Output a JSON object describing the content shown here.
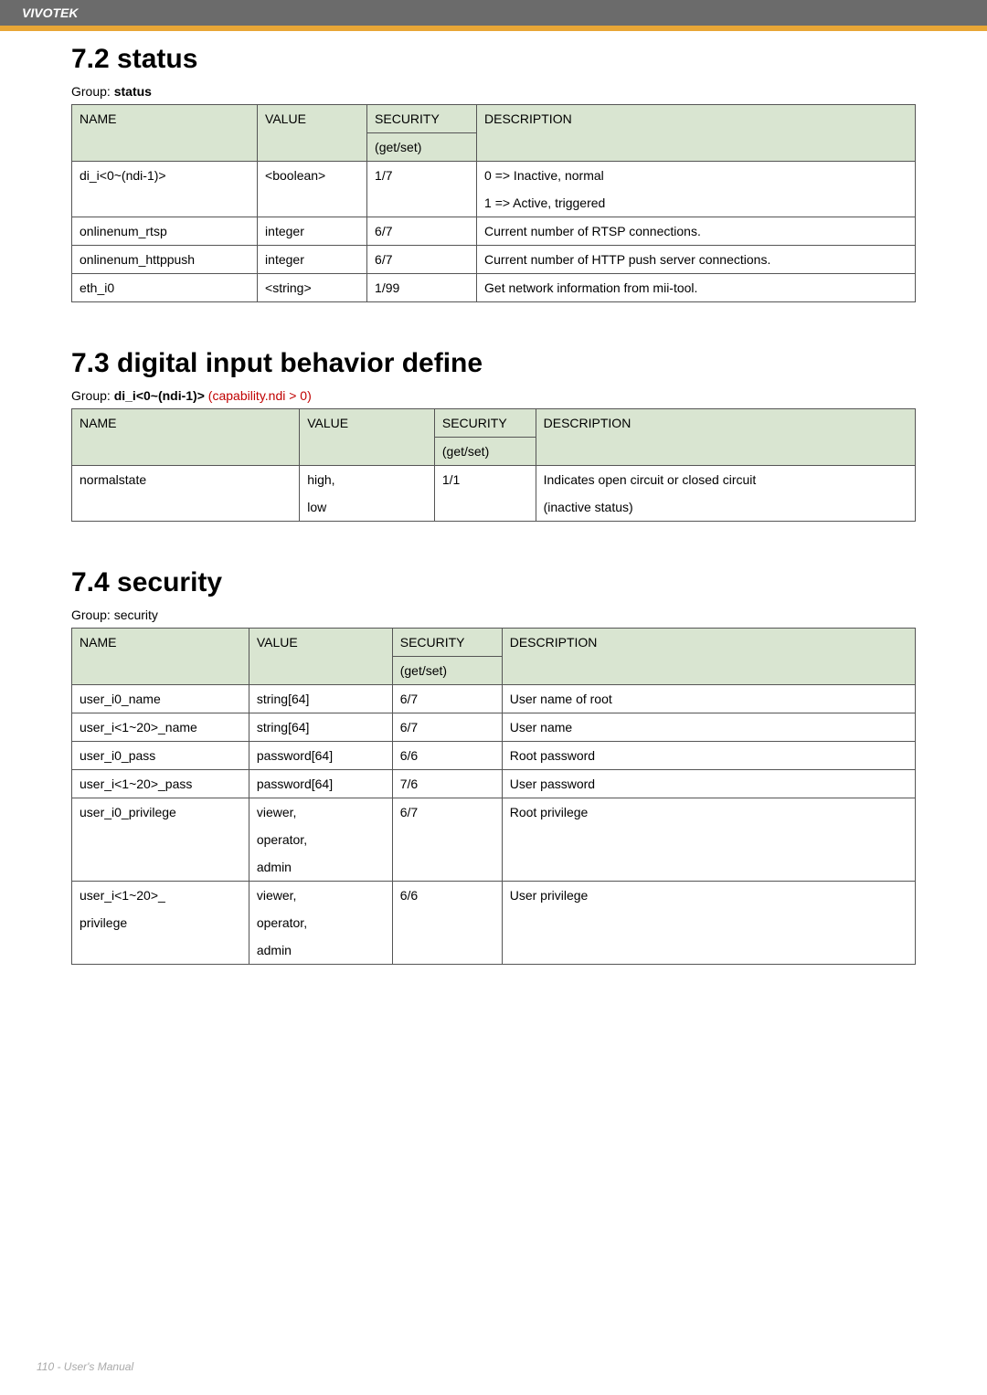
{
  "header": {
    "brand": "VIVOTEK"
  },
  "section72": {
    "title": "7.2 status",
    "group_label": "Group: ",
    "group_value": "status",
    "headers": {
      "name": "NAME",
      "value": "VALUE",
      "security": "SECURITY",
      "security_sub": "(get/set)",
      "description": "DESCRIPTION"
    },
    "rows": [
      {
        "name": "di_i<0~(ndi-1)>",
        "value": "<boolean>",
        "security": "1/7",
        "desc_line1": "0 => Inactive, normal",
        "desc_line2": "1 => Active, triggered"
      },
      {
        "name": "onlinenum_rtsp",
        "value": "integer",
        "security": "6/7",
        "desc": "Current number of RTSP connections."
      },
      {
        "name": "onlinenum_httppush",
        "value": "integer",
        "security": "6/7",
        "desc": "Current number of HTTP push server connections."
      },
      {
        "name": "eth_i0",
        "value": "<string>",
        "security": "1/99",
        "desc": "Get network information from mii-tool."
      }
    ]
  },
  "section73": {
    "title": "7.3 digital input behavior define",
    "group_label": "Group: ",
    "group_value": "di_i<0~(ndi-1)>",
    "group_suffix": " (capability.ndi > 0)",
    "headers": {
      "name": "NAME",
      "value": "VALUE",
      "security": "SECURITY",
      "security_sub": "(get/set)",
      "description": "DESCRIPTION"
    },
    "rows": [
      {
        "name": "normalstate",
        "value_line1": "high,",
        "value_line2": "low",
        "security": "1/1",
        "desc_line1": "Indicates open circuit or closed circuit",
        "desc_line2": "(inactive status)"
      }
    ]
  },
  "section74": {
    "title": "7.4 security",
    "group_label": "Group: security",
    "headers": {
      "name": "NAME",
      "value": "VALUE",
      "security": "SECURITY",
      "security_sub": "(get/set)",
      "description": "DESCRIPTION"
    },
    "rows": [
      {
        "name": "user_i0_name",
        "value": "string[64]",
        "security": "6/7",
        "desc": "User name of root"
      },
      {
        "name": "user_i<1~20>_name",
        "value": "string[64]",
        "security": "6/7",
        "desc": "User name"
      },
      {
        "name": "user_i0_pass",
        "value": "password[64]",
        "security": "6/6",
        "desc": "Root password"
      },
      {
        "name": "user_i<1~20>_pass",
        "value": "password[64]",
        "security": "7/6",
        "desc": "User password"
      },
      {
        "name": "user_i0_privilege",
        "value_line1": "viewer,",
        "value_line2": "operator,",
        "value_line3": "admin",
        "security": "6/7",
        "desc": "Root privilege"
      },
      {
        "name_line1": "user_i<1~20>_",
        "name_line2": "privilege",
        "value_line1": "viewer,",
        "value_line2": "operator,",
        "value_line3": "admin",
        "security": "6/6",
        "desc": "User privilege"
      }
    ]
  },
  "footer": {
    "text": "110 - User's Manual"
  }
}
